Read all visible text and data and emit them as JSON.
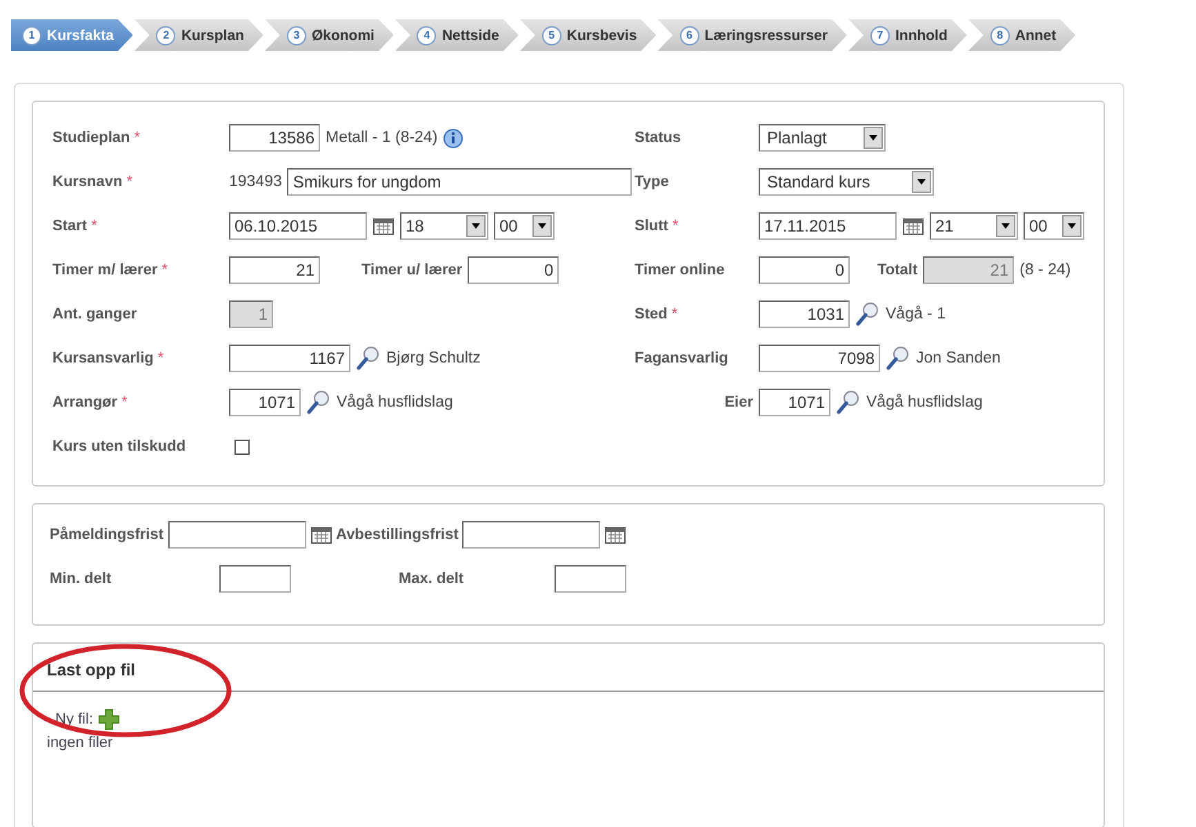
{
  "tabs": [
    {
      "number": "1",
      "label": "Kursfakta",
      "selected": true
    },
    {
      "number": "2",
      "label": "Kursplan",
      "selected": false
    },
    {
      "number": "3",
      "label": "Økonomi",
      "selected": false
    },
    {
      "number": "4",
      "label": "Nettside",
      "selected": false
    },
    {
      "number": "5",
      "label": "Kursbevis",
      "selected": false
    },
    {
      "number": "6",
      "label": "Læringsressurser",
      "selected": false
    },
    {
      "number": "7",
      "label": "Innhold",
      "selected": false
    },
    {
      "number": "8",
      "label": "Annet",
      "selected": false
    }
  ],
  "course_details": {
    "rows": [
      {
        "left": [
          {
            "kind": "label",
            "text": "Studieplan",
            "marker": "*"
          },
          {
            "kind": "number",
            "value": "13586"
          },
          {
            "kind": "text",
            "text": "Metall - 1 (8-24)"
          },
          {
            "kind": "info"
          }
        ],
        "right": [
          {
            "kind": "label",
            "text": "Status"
          },
          {
            "kind": "select",
            "value": "Planlagt"
          }
        ]
      },
      {
        "left": [
          {
            "kind": "label",
            "text": "Kursnavn",
            "marker": "*"
          },
          {
            "kind": "text",
            "text": "193493"
          },
          {
            "kind": "wide",
            "value": "Smikurs for ungdom"
          }
        ],
        "right": [
          {
            "kind": "label",
            "text": "Type"
          },
          {
            "kind": "select",
            "value": "Standard kurs"
          }
        ]
      },
      {
        "left": [
          {
            "kind": "label",
            "text": "Start",
            "marker": "*"
          },
          {
            "kind": "date",
            "value": "06.10.2015"
          },
          {
            "kind": "calendar"
          },
          {
            "kind": "hour",
            "value": "18"
          },
          {
            "kind": "minute",
            "value": "00"
          }
        ],
        "right": [
          {
            "kind": "label",
            "text": "Slutt",
            "marker": "*"
          },
          {
            "kind": "date",
            "value": "17.11.2015"
          },
          {
            "kind": "calendar"
          },
          {
            "kind": "hour",
            "value": "21"
          },
          {
            "kind": "minute",
            "value": "00"
          }
        ]
      },
      {
        "left": [
          {
            "kind": "label",
            "text": "Timer m/ lærer",
            "marker": "*"
          },
          {
            "kind": "number",
            "value": "21",
            "disabled": false
          },
          {
            "kind": "inline-label",
            "text": "Timer u/ lærer"
          },
          {
            "kind": "number",
            "value": "0",
            "disabled": false
          }
        ],
        "right": [
          {
            "kind": "label",
            "text": "Timer online"
          },
          {
            "kind": "number",
            "value": "0",
            "disabled": false
          },
          {
            "kind": "inline-label",
            "text": "Totalt"
          },
          {
            "kind": "number",
            "value": "21",
            "disabled": true
          },
          {
            "kind": "text",
            "text": "(8 - 24)"
          }
        ]
      },
      {
        "left": [
          {
            "kind": "label",
            "text": "Ant. ganger"
          },
          {
            "kind": "tiny",
            "value": "1",
            "disabled": true
          }
        ],
        "right": [
          {
            "kind": "label",
            "text": "Sted",
            "marker": "*"
          },
          {
            "kind": "number",
            "value": "1031",
            "disabled": false
          },
          {
            "kind": "lookup"
          },
          {
            "kind": "text",
            "text": "Vågå - 1"
          }
        ]
      },
      {
        "left": [
          {
            "kind": "label",
            "text": "Kursansvarlig",
            "marker": "*"
          },
          {
            "kind": "wide-number",
            "value": "1167",
            "disabled": false
          },
          {
            "kind": "lookup"
          },
          {
            "kind": "text",
            "text": "Bjørg Schultz"
          }
        ],
        "right": [
          {
            "kind": "label",
            "text": "Fagansvarlig"
          },
          {
            "kind": "wide-number",
            "value": "7098",
            "disabled": false
          },
          {
            "kind": "lookup"
          },
          {
            "kind": "text",
            "text": "Jon Sanden"
          }
        ]
      },
      {
        "left": [
          {
            "kind": "label",
            "text": "Arrangør",
            "marker": "*"
          },
          {
            "kind": "short",
            "value": "1071",
            "disabled": false
          },
          {
            "kind": "lookup"
          },
          {
            "kind": "text",
            "text": "Vågå husflidslag"
          }
        ],
        "right": [
          {
            "kind": "end-label",
            "text": "Eier"
          },
          {
            "kind": "short",
            "value": "1071",
            "disabled": false
          },
          {
            "kind": "lookup"
          },
          {
            "kind": "text",
            "text": "Vågå husflidslag"
          }
        ]
      },
      {
        "left": [
          {
            "kind": "label",
            "text": "Kurs uten tilskudd"
          },
          {
            "kind": "checkbox",
            "checked": false
          }
        ],
        "right": []
      }
    ]
  },
  "deadlines": {
    "rows": [
      [
        {
          "kind": "label",
          "text": "Påmeldingsfrist"
        },
        {
          "kind": "date"
        },
        {
          "kind": "calendar"
        },
        {
          "kind": "label",
          "text": "Avbestillingsfrist"
        },
        {
          "kind": "date"
        },
        {
          "kind": "calendar"
        }
      ],
      [
        {
          "kind": "label",
          "text": "Min. delt"
        },
        {
          "kind": "small"
        },
        {
          "kind": "spacer"
        },
        {
          "kind": "label",
          "text": "Max. delt"
        },
        {
          "kind": "small"
        }
      ]
    ]
  },
  "upload": {
    "title": "Last opp fil",
    "new_file_label": "Ny fil:",
    "empty_text": "ingen filer"
  }
}
